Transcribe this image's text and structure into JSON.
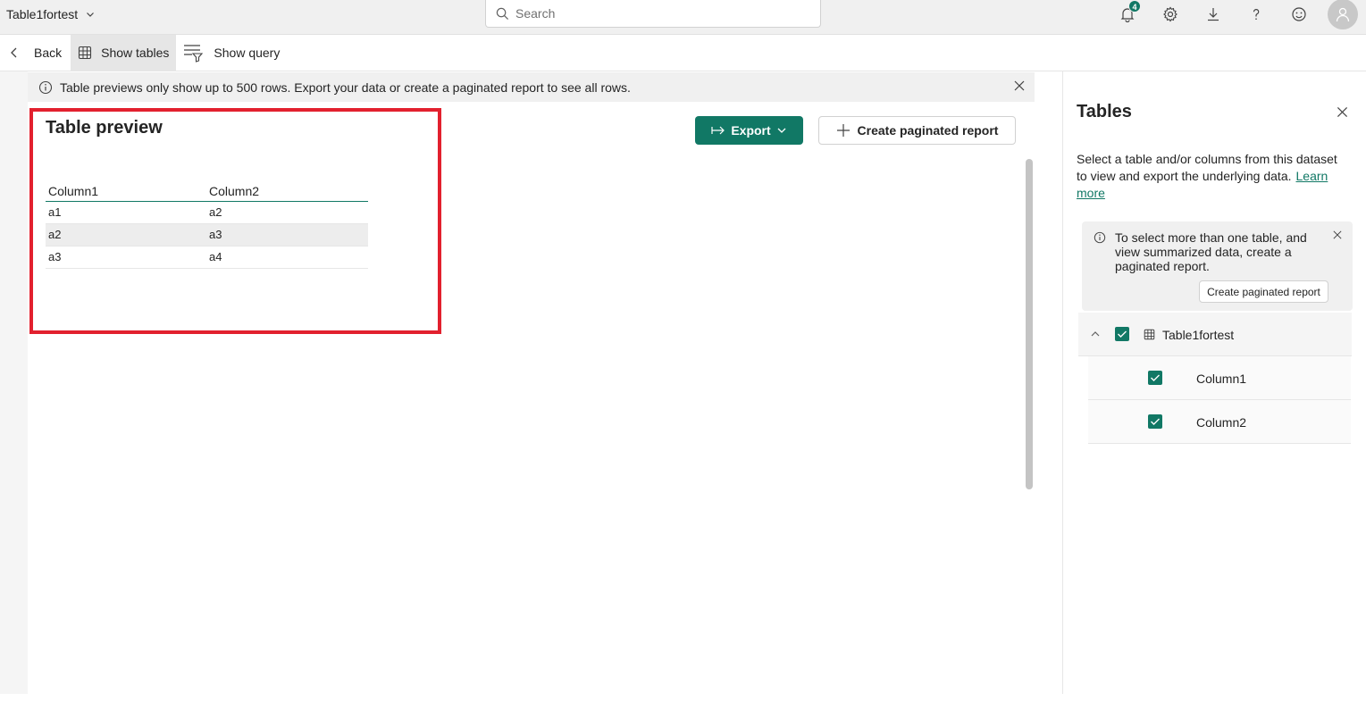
{
  "header": {
    "app_title": "Table1fortest",
    "search_placeholder": "Search",
    "notifications_count": "4",
    "icons": [
      "bell-icon",
      "gear-icon",
      "download-icon",
      "help-icon",
      "feedback-icon",
      "avatar-icon"
    ]
  },
  "toolbar": {
    "back_label": "Back",
    "show_tables_label": "Show tables",
    "show_query_label": "Show query"
  },
  "info_banner": {
    "text": "Table previews only show up to 500 rows. Export your data or create a paginated report to see all rows."
  },
  "preview": {
    "title": "Table preview",
    "export_label": "Export",
    "create_report_label": "Create paginated report",
    "columns": [
      "Column1",
      "Column2"
    ],
    "rows": [
      [
        "a1",
        "a2"
      ],
      [
        "a2",
        "a3"
      ],
      [
        "a3",
        "a4"
      ]
    ]
  },
  "tables_panel": {
    "title": "Tables",
    "description": "Select a table and/or columns from this dataset to view and export the underlying data.",
    "learn_more": "Learn more",
    "note_text": "To select more than one table, and view summarized data, create a paginated report.",
    "note_button": "Create paginated report",
    "table_name": "Table1fortest",
    "columns": [
      {
        "label": "Column1",
        "checked": true
      },
      {
        "label": "Column2",
        "checked": true
      }
    ]
  },
  "colors": {
    "accent": "#117865",
    "highlight": "#e2202e"
  }
}
